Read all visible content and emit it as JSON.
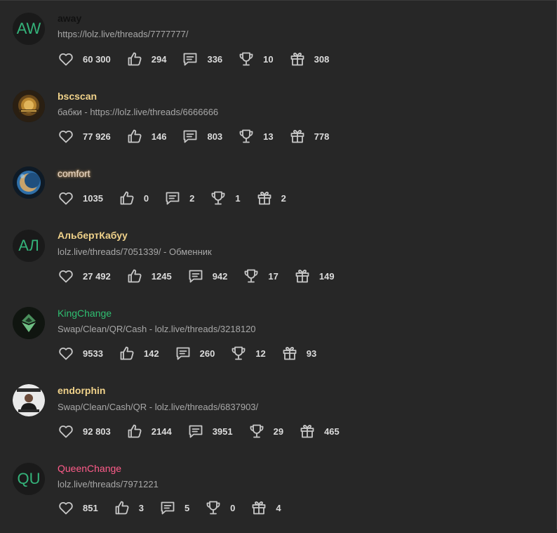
{
  "users": [
    {
      "avatar": {
        "type": "initials",
        "text": "AW"
      },
      "name": "away",
      "name_color": "#111111",
      "status": "https://lolz.live/threads/7777777/",
      "stats": {
        "likes": "60 300",
        "sympathy": "294",
        "messages": "336",
        "trophies": "10",
        "gifts": "308"
      }
    },
    {
      "avatar": {
        "type": "image",
        "icon": "bscscan-gold-coin"
      },
      "name": "bscscan",
      "name_color": "#f0d28a",
      "status": "бабки - https://lolz.live/threads/6666666",
      "stats": {
        "likes": "77 926",
        "sympathy": "146",
        "messages": "803",
        "trophies": "13",
        "gifts": "778"
      }
    },
    {
      "avatar": {
        "type": "image",
        "icon": "comfort-crescent-moon"
      },
      "name": "comfort",
      "name_color": "#e8d8c8",
      "status": "",
      "stats": {
        "likes": "1035",
        "sympathy": "0",
        "messages": "2",
        "trophies": "1",
        "gifts": "2"
      }
    },
    {
      "avatar": {
        "type": "initials",
        "text": "АЛ"
      },
      "name": "АльбертКабуу",
      "name_color": "#f0d28a",
      "status": "lolz.live/threads/7051339/ - Обменник",
      "stats": {
        "likes": "27 492",
        "sympathy": "1245",
        "messages": "942",
        "trophies": "17",
        "gifts": "149"
      }
    },
    {
      "avatar": {
        "type": "image",
        "icon": "kingchange-diamond-logo"
      },
      "name": "KingChange",
      "name_color": "#2fbf71",
      "status": "Swap/Clean/QR/Cash - lolz.live/threads/3218120",
      "stats": {
        "likes": "9533",
        "sympathy": "142",
        "messages": "260",
        "trophies": "12",
        "gifts": "93"
      }
    },
    {
      "avatar": {
        "type": "image",
        "icon": "endorphin-photo"
      },
      "name": "endorphin",
      "name_color": "#f0d28a",
      "status": "Swap/Clean/Cash/QR - lolz.live/threads/6837903/",
      "stats": {
        "likes": "92 803",
        "sympathy": "2144",
        "messages": "3951",
        "trophies": "29",
        "gifts": "465"
      }
    },
    {
      "avatar": {
        "type": "initials",
        "text": "QU"
      },
      "name": "QueenChange",
      "name_color": "#ff5c8a",
      "status": "lolz.live/threads/7971221",
      "stats": {
        "likes": "851",
        "sympathy": "3",
        "messages": "5",
        "trophies": "0",
        "gifts": "4"
      }
    }
  ],
  "icons": {
    "likes": "heart-icon",
    "sympathy": "thumbs-up-icon",
    "messages": "message-icon",
    "trophies": "trophy-icon",
    "gifts": "gift-icon"
  },
  "colors": {
    "background": "#272727",
    "icon": "#c8c8c8",
    "initials": "#34b37a"
  }
}
